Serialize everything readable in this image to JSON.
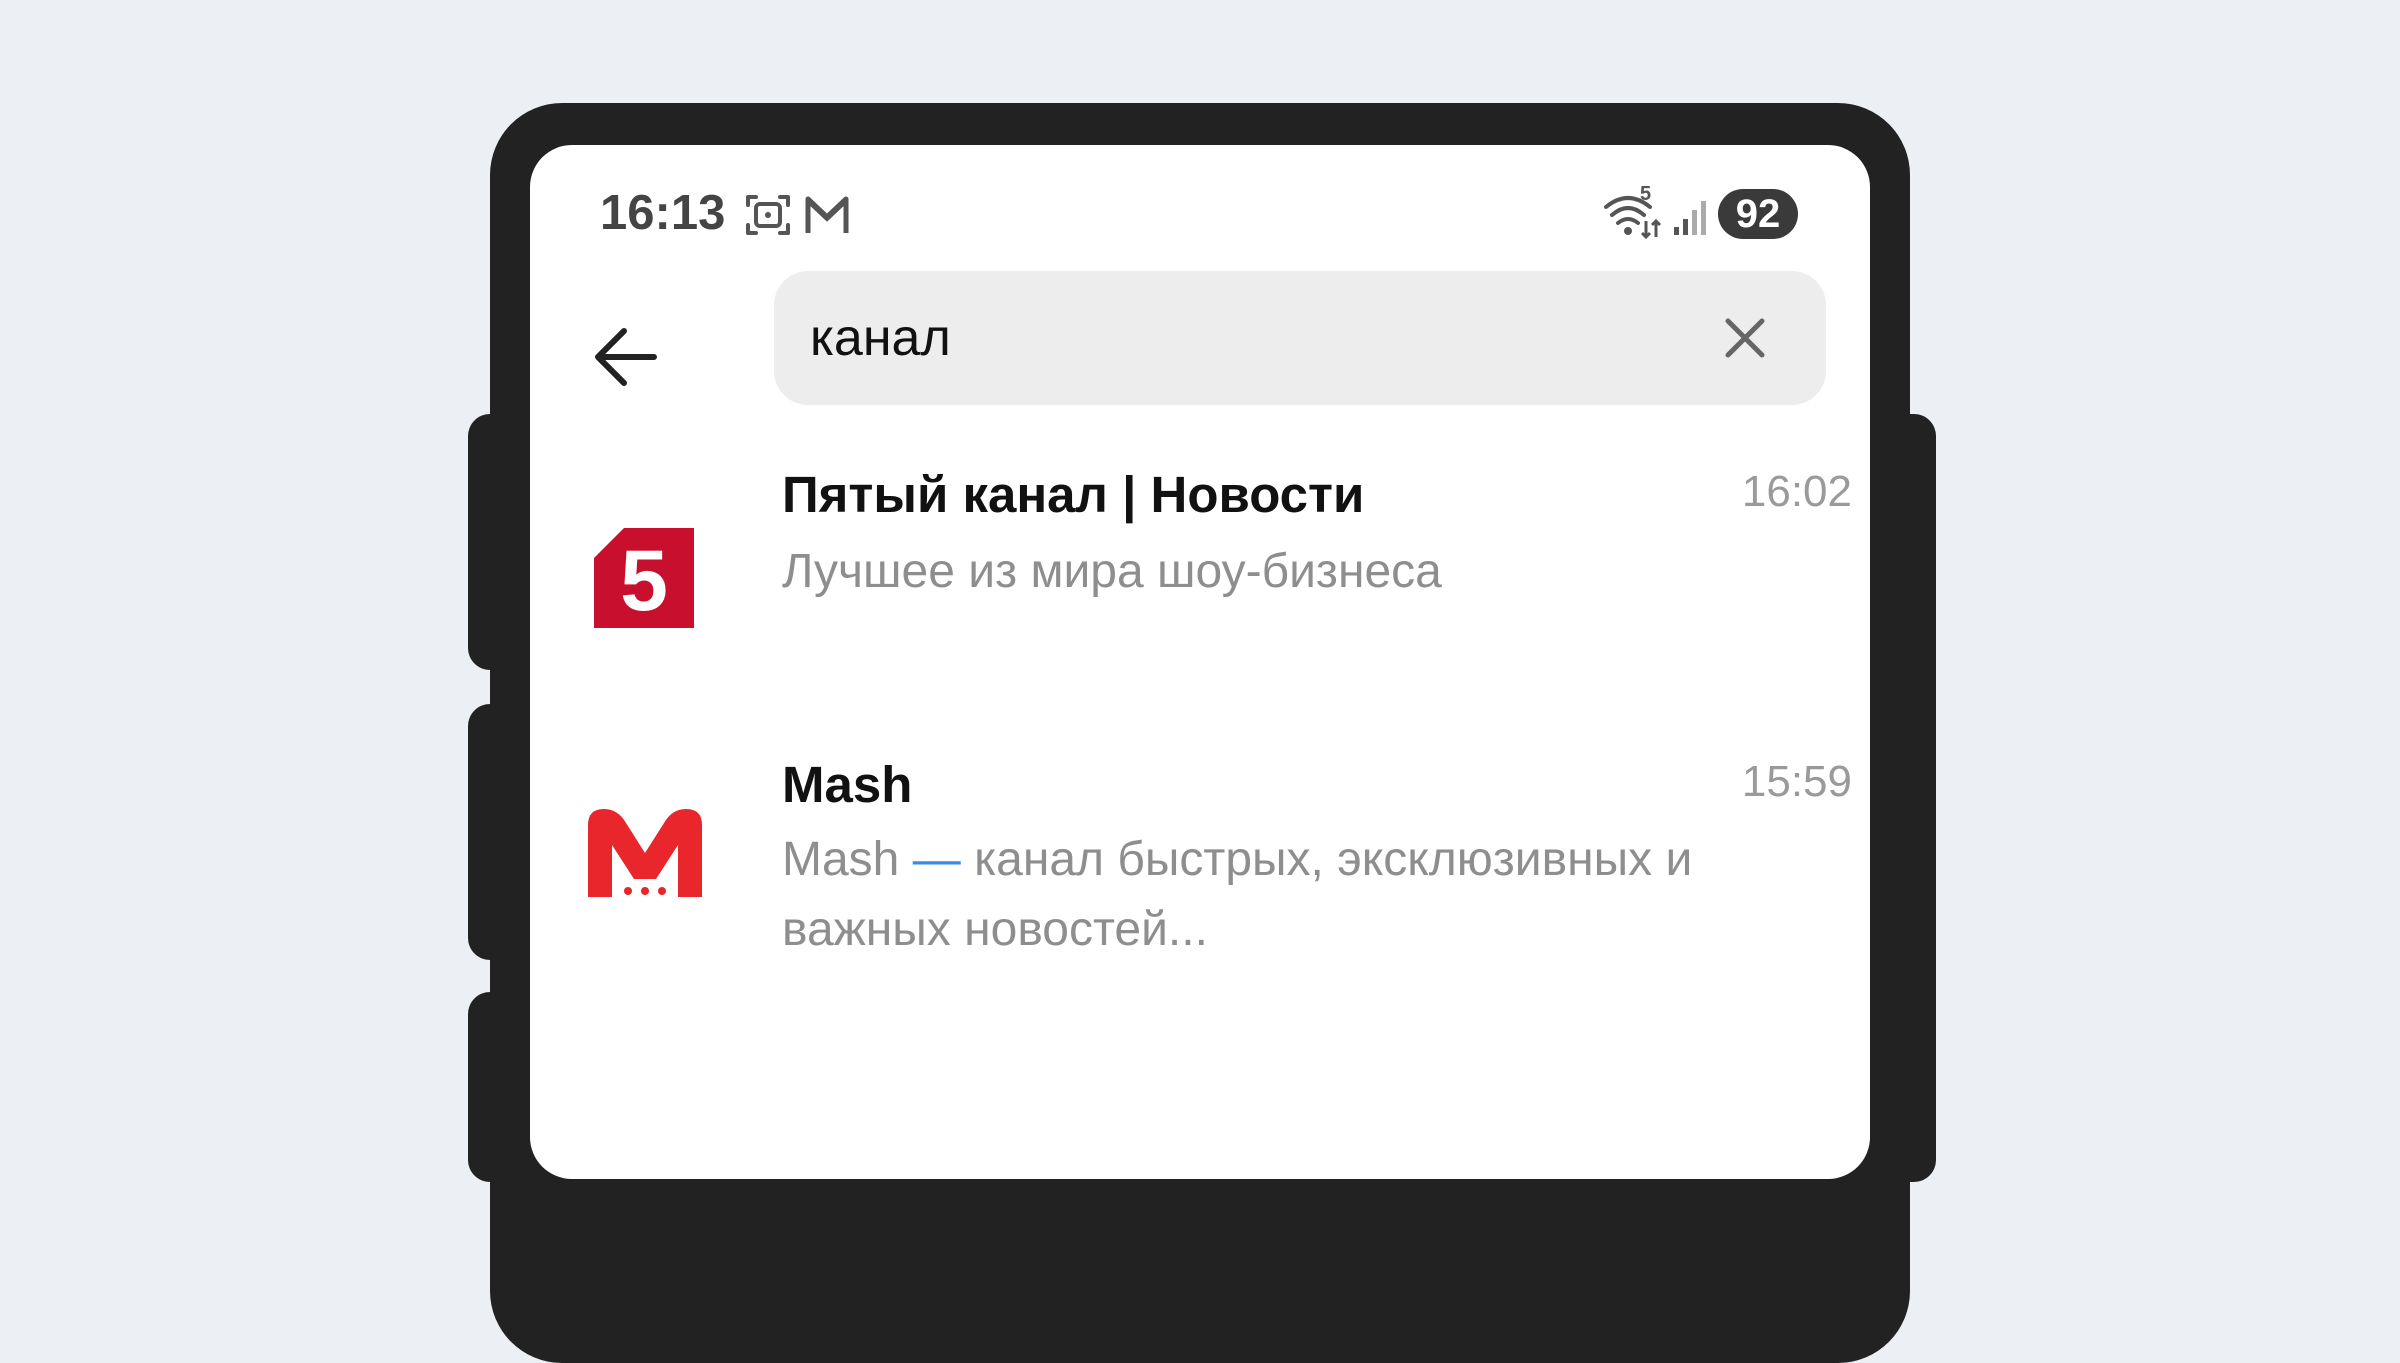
{
  "status_bar": {
    "time": "16:13",
    "battery": "92",
    "wifi_label": "5"
  },
  "search": {
    "query": "канал"
  },
  "results": [
    {
      "title": "Пятый канал | Новости",
      "time": "16:02",
      "subtitle": "Лучшее из мира шоу-бизнеса",
      "avatar_text": "5",
      "avatar_color": "#C8102E"
    },
    {
      "title": "Mash",
      "time": "15:59",
      "subtitle_prefix": "Mash",
      "subtitle_dash": "—",
      "subtitle_rest": "канал быстрых, эксклюзивных и важных новостей...",
      "avatar_color": "#E8262B"
    }
  ],
  "colors": {
    "background": "#ECF0F5",
    "frame": "#222222",
    "accent_blue": "#3C8BE6"
  }
}
